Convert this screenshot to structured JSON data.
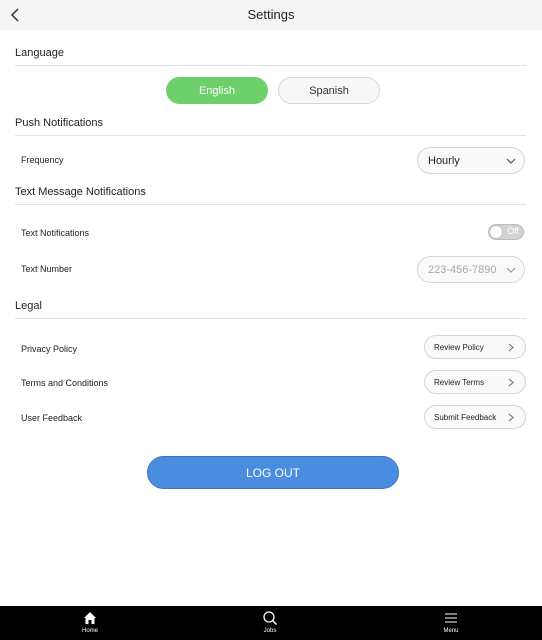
{
  "header": {
    "title": "Settings"
  },
  "sections": {
    "language": "Language",
    "push": "Push Notifications",
    "text": "Text Message Notifications",
    "legal": "Legal"
  },
  "language": {
    "english": "English",
    "spanish": "Spanish",
    "selected": "English"
  },
  "push": {
    "frequency_label": "Frequency",
    "frequency_value": "Hourly"
  },
  "text": {
    "notifications_label": "Text Notifications",
    "toggle_state": "Off",
    "number_label": "Text Number",
    "number_value": "223-456-7890"
  },
  "legal": {
    "privacy_label": "Privacy Policy",
    "privacy_button": "Review Policy",
    "terms_label": "Terms and Conditions",
    "terms_button": "Review Terms",
    "feedback_label": "User Feedback",
    "feedback_button": "Submit Feedback"
  },
  "logout_label": "LOG OUT",
  "tabbar": {
    "home": "Home",
    "jobs": "Jobs",
    "menu": "Menu"
  },
  "colors": {
    "accent_green": "#6dd06a",
    "accent_blue": "#4a8de0",
    "tabbar_bg": "#000000"
  }
}
